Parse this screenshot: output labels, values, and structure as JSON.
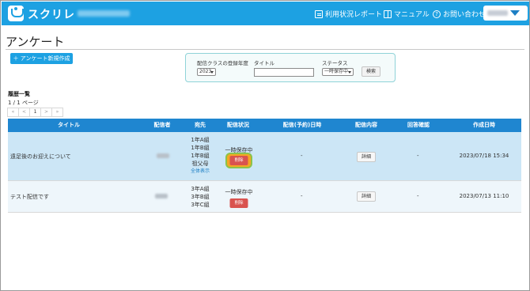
{
  "header": {
    "app_name": "スクリレ",
    "nav": {
      "usage_report": "利用状況レポート",
      "manual": "マニュアル",
      "contact": "お問い合わせ"
    }
  },
  "page": {
    "title": "アンケート",
    "new_button": "＋ アンケート新規作成"
  },
  "filter": {
    "year_label": "配信クラスの登録年度",
    "year_value": "2023",
    "title_label": "タイトル",
    "title_value": "",
    "status_label": "ステータス",
    "status_value": "一時保存中",
    "search_button": "検索"
  },
  "history": {
    "label": "履歴一覧",
    "page_count": "1 / 1 ページ",
    "pager": [
      "«",
      "<",
      "1",
      ">",
      "»"
    ]
  },
  "table": {
    "columns": [
      "タイトル",
      "配信者",
      "宛先",
      "配信状況",
      "配信(予約)日時",
      "配信内容",
      "回答確認",
      "作成日時"
    ],
    "rows": [
      {
        "title": "遠足後のお迎えについて",
        "destinations": [
          "1年A組",
          "1年B組",
          "1年B組",
          "祖父母"
        ],
        "show_all": "全体表示",
        "status": "一時保存中",
        "delete": "削除",
        "scheduled": "-",
        "detail": "詳細",
        "answers": "-",
        "created": "2023/07/18 15:34"
      },
      {
        "title": "テスト配信です",
        "destinations": [
          "3年A組",
          "3年B組",
          "3年C組"
        ],
        "status": "一時保存中",
        "delete": "削除",
        "scheduled": "-",
        "detail": "詳細",
        "answers": "-",
        "created": "2023/07/13 11:10"
      }
    ]
  },
  "colors": {
    "header_bg": "#1da1e2",
    "table_header": "#1f86d0",
    "selected_row": "#cce6f6",
    "delete_button": "#d9534f",
    "highlight": "#f5a623"
  }
}
